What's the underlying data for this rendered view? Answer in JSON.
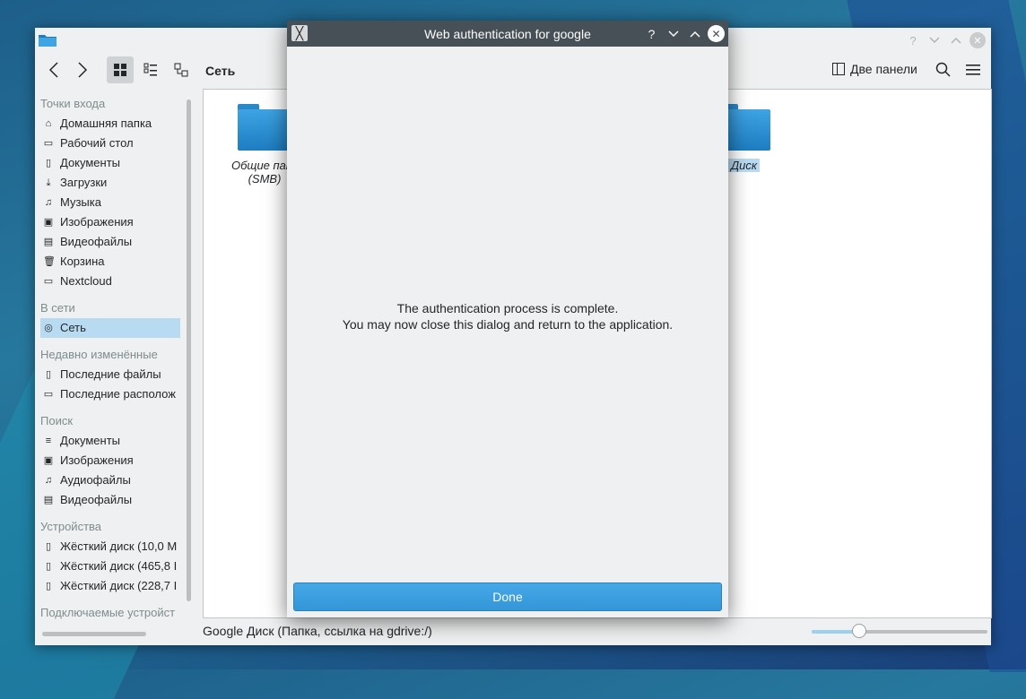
{
  "dialog": {
    "title": "Web authentication for google",
    "message_line1": "The authentication process is complete.",
    "message_line2": "You may now close this dialog and return to the application.",
    "done_label": "Done",
    "help_glyph": "?"
  },
  "toolbar": {
    "location": "Сеть",
    "split_label": "Две панели"
  },
  "sidebar": {
    "sections": [
      {
        "header": "Точки входа",
        "items": [
          {
            "label": "Домашняя папка",
            "icon": "home-icon"
          },
          {
            "label": "Рабочий стол",
            "icon": "desktop-icon"
          },
          {
            "label": "Документы",
            "icon": "documents-icon"
          },
          {
            "label": "Загрузки",
            "icon": "download-icon"
          },
          {
            "label": "Музыка",
            "icon": "music-icon"
          },
          {
            "label": "Изображения",
            "icon": "image-icon"
          },
          {
            "label": "Видеофайлы",
            "icon": "video-icon"
          },
          {
            "label": "Корзина",
            "icon": "trash-icon"
          },
          {
            "label": "Nextcloud",
            "icon": "folder-icon"
          }
        ]
      },
      {
        "header": "В сети",
        "items": [
          {
            "label": "Сеть",
            "icon": "network-icon",
            "selected": true
          }
        ]
      },
      {
        "header": "Недавно изменённые",
        "items": [
          {
            "label": "Последние файлы",
            "icon": "recent-files-icon"
          },
          {
            "label": "Последние располож",
            "icon": "recent-locations-icon"
          }
        ]
      },
      {
        "header": "Поиск",
        "items": [
          {
            "label": "Документы",
            "icon": "documents-icon"
          },
          {
            "label": "Изображения",
            "icon": "image-icon"
          },
          {
            "label": "Аудиофайлы",
            "icon": "music-icon"
          },
          {
            "label": "Видеофайлы",
            "icon": "video-icon"
          }
        ]
      },
      {
        "header": "Устройства",
        "items": [
          {
            "label": "Жёсткий диск (10,0 М",
            "icon": "harddisk-warning-icon"
          },
          {
            "label": "Жёсткий диск (465,8 I",
            "icon": "harddisk-icon"
          },
          {
            "label": "Жёсткий диск (228,7 I",
            "icon": "harddisk-icon"
          }
        ]
      },
      {
        "header": "Подключаемые устройст",
        "items": []
      }
    ]
  },
  "main": {
    "items": [
      {
        "label_line1": "Общие папк",
        "label_line2": "(SMB)"
      },
      {
        "label_line1": "Диск"
      }
    ]
  },
  "status": {
    "text": "Google Диск (Папка, ссылка на gdrive:/)",
    "zoom_fraction": 0.27
  },
  "colors": {
    "accent": "#3daee9",
    "selection": "#b9dbf1",
    "dialog_titlebar": "#475057"
  }
}
